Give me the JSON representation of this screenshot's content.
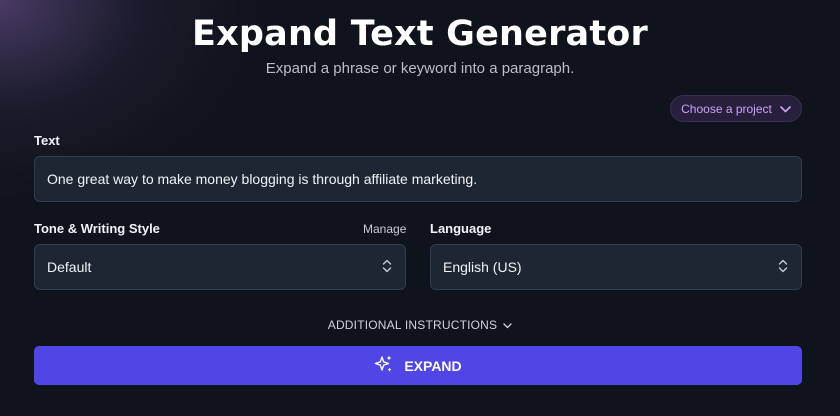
{
  "header": {
    "title": "Expand Text Generator",
    "subtitle": "Expand a phrase or keyword into a paragraph."
  },
  "project": {
    "label": "Choose a project",
    "icon": "chevron-down-icon"
  },
  "text_field": {
    "label": "Text",
    "value": "One great way to make money blogging is through affiliate marketing."
  },
  "tone": {
    "label": "Tone & Writing Style",
    "manage_label": "Manage",
    "value": "Default",
    "icon": "updown-arrows-icon"
  },
  "language": {
    "label": "Language",
    "value": "English (US)",
    "icon": "updown-arrows-icon"
  },
  "additional_instructions": {
    "label": "ADDITIONAL INSTRUCTIONS",
    "icon": "chevron-down-icon"
  },
  "expand_button": {
    "label": "EXPAND",
    "icon": "sparkles-icon",
    "color": "#4f46e5"
  },
  "colors": {
    "background": "#0f131b",
    "field": "#1e2633",
    "accent": "#4f46e5",
    "project_text": "#c9a6f5"
  }
}
